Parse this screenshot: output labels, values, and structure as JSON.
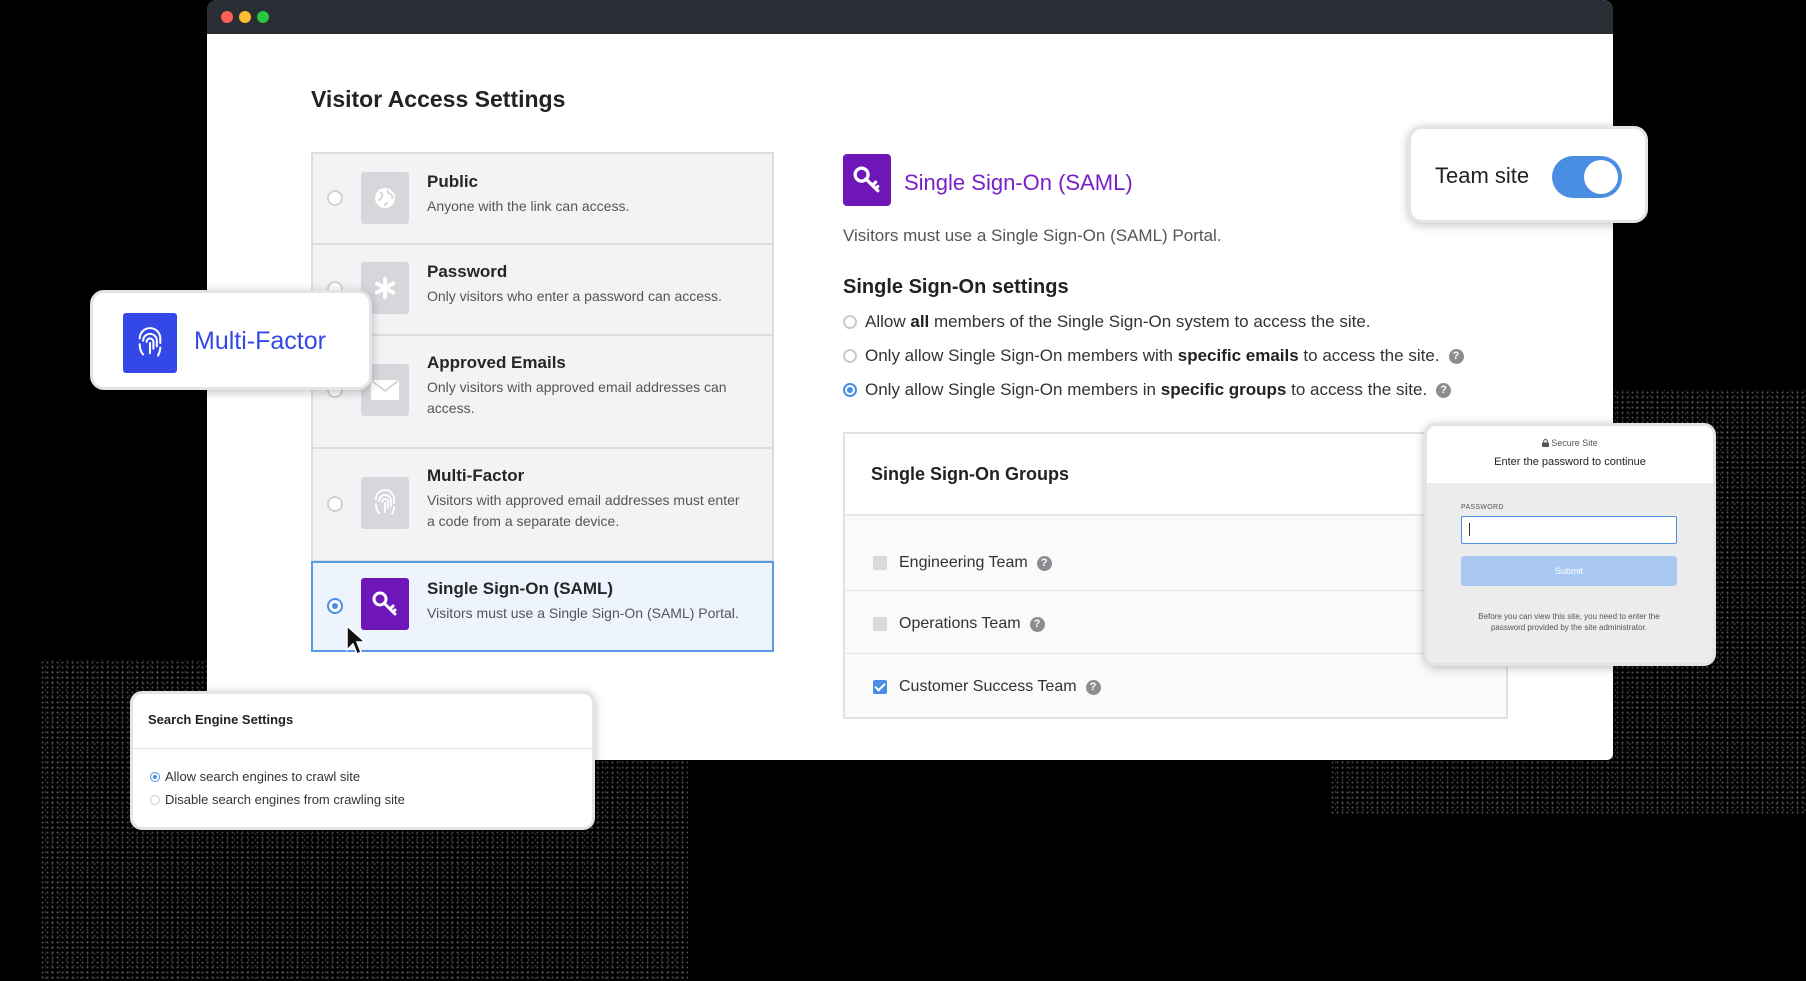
{
  "window": {
    "traffic_lights": [
      "close",
      "minimize",
      "zoom"
    ]
  },
  "page": {
    "title": "Visitor Access Settings"
  },
  "access_options": [
    {
      "title": "Public",
      "description": "Anyone with the link can access.",
      "icon": "globe-icon",
      "selected": false
    },
    {
      "title": "Password",
      "description": "Only visitors who enter a password can access.",
      "icon": "asterisk-icon",
      "selected": false
    },
    {
      "title": "Approved Emails",
      "description": "Only visitors with approved email addresses can access.",
      "icon": "envelope-icon",
      "selected": false
    },
    {
      "title": "Multi-Factor",
      "description": "Visitors with approved email addresses must enter a code from a separate device.",
      "icon": "fingerprint-icon",
      "selected": false
    },
    {
      "title": "Single Sign-On (SAML)",
      "description": "Visitors must use a Single Sign-On (SAML) Portal.",
      "icon": "key-icon",
      "selected": true
    }
  ],
  "detail": {
    "title": "Single Sign-On (SAML)",
    "description": "Visitors must use a Single Sign-On (SAML) Portal.",
    "settings_heading": "Single Sign-On settings",
    "options": [
      {
        "pre": "Allow ",
        "bold": "all",
        "post": " members of the Single Sign-On system to access the site.",
        "selected": false,
        "help": false
      },
      {
        "pre": "Only allow Single Sign-On members with ",
        "bold": "specific emails",
        "post": " to access the site.",
        "selected": false,
        "help": true
      },
      {
        "pre": "Only allow Single Sign-On members in ",
        "bold": "specific groups",
        "post": " to access the site.",
        "selected": true,
        "help": true
      }
    ],
    "groups_title": "Single Sign-On Groups",
    "groups": [
      {
        "name": "Engineering Team",
        "checked": false
      },
      {
        "name": "Operations Team",
        "checked": false
      },
      {
        "name": "Customer Success Team",
        "checked": true
      }
    ]
  },
  "team_site": {
    "label": "Team site",
    "enabled": true
  },
  "multi_factor_card": {
    "label": "Multi-Factor"
  },
  "search_engine": {
    "title": "Search Engine Settings",
    "options": [
      {
        "label": "Allow search engines to crawl site",
        "selected": true
      },
      {
        "label": "Disable search engines from crawling site",
        "selected": false
      }
    ]
  },
  "password_prompt": {
    "secure_label": "Secure Site",
    "heading": "Enter the password to continue",
    "field_label": "PASSWORD",
    "submit_label": "Submit",
    "note": "Before you can view this site, you need to enter the password provided by the site administrator."
  },
  "colors": {
    "accent_blue": "#4a8ee3",
    "saml_purple": "#6e16b8",
    "mfa_blue": "#3448e8"
  }
}
